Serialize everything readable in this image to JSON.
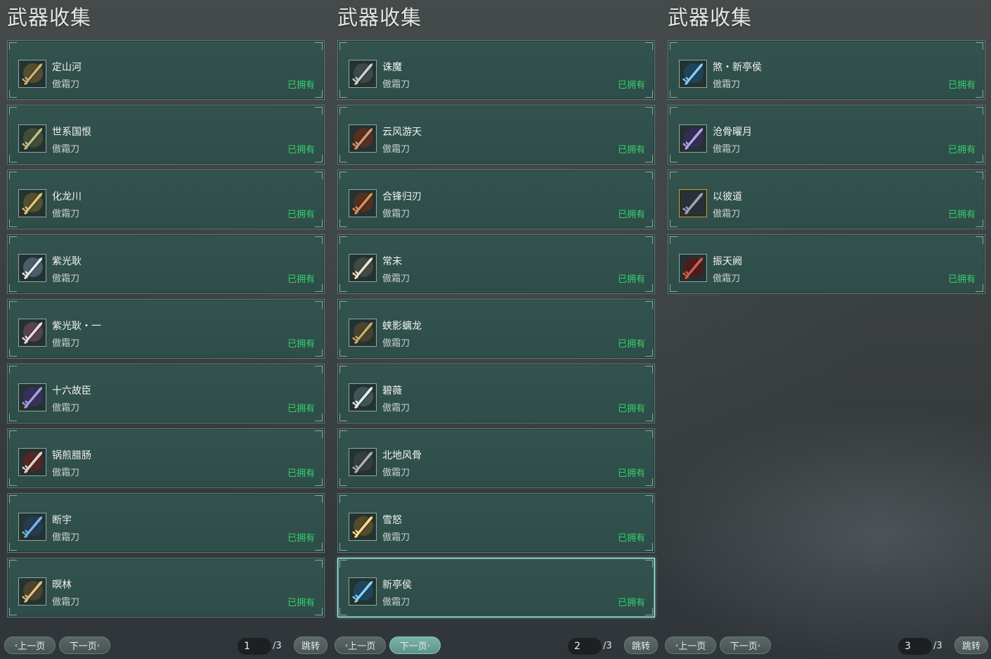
{
  "panels": [
    {
      "title": "武器收集",
      "items": [
        {
          "name": "定山河",
          "type": "傲霜刀",
          "status": "已拥有",
          "icon": "blade-icon",
          "c1": "#6b5a2f",
          "c2": "#c9b071"
        },
        {
          "name": "世系国恨",
          "type": "傲霜刀",
          "status": "已拥有",
          "icon": "blade-icon",
          "c1": "#4f5a3a",
          "c2": "#b9bd86"
        },
        {
          "name": "化龙川",
          "type": "傲霜刀",
          "status": "已拥有",
          "icon": "blade-icon",
          "c1": "#6a5b2c",
          "c2": "#d8c27a"
        },
        {
          "name": "紫光耿",
          "type": "傲霜刀",
          "status": "已拥有",
          "icon": "blade-icon",
          "c1": "#5b6f85",
          "c2": "#dfe8f2"
        },
        {
          "name": "紫光耿・一",
          "type": "傲霜刀",
          "status": "已拥有",
          "icon": "blade-icon",
          "c1": "#6d4b57",
          "c2": "#e9d7df"
        },
        {
          "name": "十六故臣",
          "type": "傲霜刀",
          "status": "已拥有",
          "icon": "blade-icon",
          "c1": "#3e2f6e",
          "c2": "#a79ae6"
        },
        {
          "name": "锅煎腊肠",
          "type": "傲霜刀",
          "status": "已拥有",
          "icon": "blade-icon",
          "c1": "#6e2020",
          "c2": "#e1cfc4"
        },
        {
          "name": "断宇",
          "type": "傲霜刀",
          "status": "已拥有",
          "icon": "blade-icon",
          "c1": "#23405f",
          "c2": "#6fb2e6"
        },
        {
          "name": "暝林",
          "type": "傲霜刀",
          "status": "已拥有",
          "icon": "blade-icon",
          "c1": "#5e4b2a",
          "c2": "#d8bf86"
        }
      ],
      "pager": {
        "prev": "上一页",
        "next": "下一页",
        "page": "1",
        "total": "/3",
        "jump": "跳转"
      }
    },
    {
      "title": "武器收集",
      "items": [
        {
          "name": "诛魔",
          "type": "傲霜刀",
          "status": "已拥有",
          "icon": "blade-icon",
          "c1": "#4c5252",
          "c2": "#c7cdcc"
        },
        {
          "name": "云风游天",
          "type": "傲霜刀",
          "status": "已拥有",
          "icon": "blade-icon",
          "c1": "#6b2d1d",
          "c2": "#d9936b"
        },
        {
          "name": "合锋归刃",
          "type": "傲霜刀",
          "status": "已拥有",
          "icon": "blade-icon",
          "c1": "#6a2e1e",
          "c2": "#e08a55"
        },
        {
          "name": "常未",
          "type": "傲霜刀",
          "status": "已拥有",
          "icon": "blade-icon",
          "c1": "#4d5350",
          "c2": "#e6e1c8"
        },
        {
          "name": "蛱影螭龙",
          "type": "傲霜刀",
          "status": "已拥有",
          "icon": "blade-icon",
          "c1": "#5b4a2c",
          "c2": "#c6a869"
        },
        {
          "name": "碧薇",
          "type": "傲霜刀",
          "status": "已拥有",
          "icon": "blade-icon",
          "c1": "#4f6466",
          "c2": "#dfeff0"
        },
        {
          "name": "北地风骨",
          "type": "傲霜刀",
          "status": "已拥有",
          "icon": "blade-icon",
          "c1": "#3f4244",
          "c2": "#a8adb0"
        },
        {
          "name": "雪怒",
          "type": "傲霜刀",
          "status": "已拥有",
          "icon": "blade-icon",
          "c1": "#6b5524",
          "c2": "#f0d88c"
        },
        {
          "name": "新亭侯",
          "type": "傲霜刀",
          "status": "已拥有",
          "icon": "blade-icon",
          "c1": "#1f4f73",
          "c2": "#7fd0f2"
        }
      ],
      "pager": {
        "prev": "上一页",
        "next": "下一页",
        "page": "2",
        "total": "/3",
        "jump": "跳转"
      }
    },
    {
      "title": "武器收集",
      "items": [
        {
          "name": "煞・新亭侯",
          "type": "傲霜刀",
          "status": "已拥有",
          "icon": "blade-icon",
          "c1": "#1f4a70",
          "c2": "#79c9f4"
        },
        {
          "name": "沧骨曜月",
          "type": "傲霜刀",
          "status": "已拥有",
          "icon": "blade-icon",
          "c1": "#3d2a66",
          "c2": "#b3a0ea"
        },
        {
          "name": "以彼道",
          "type": "傲霜刀",
          "status": "已拥有",
          "icon": "blade-icon",
          "c1": "#2d2d3e",
          "c2": "#9da0b8",
          "gold": true
        },
        {
          "name": "振天阙",
          "type": "傲霜刀",
          "status": "已拥有",
          "icon": "blade-icon",
          "c1": "#5c1414",
          "c2": "#d45a4a"
        }
      ],
      "pager": {
        "prev": "上一页",
        "next": "下一页",
        "page": "3",
        "total": "/3",
        "jump": "跳转"
      }
    }
  ]
}
